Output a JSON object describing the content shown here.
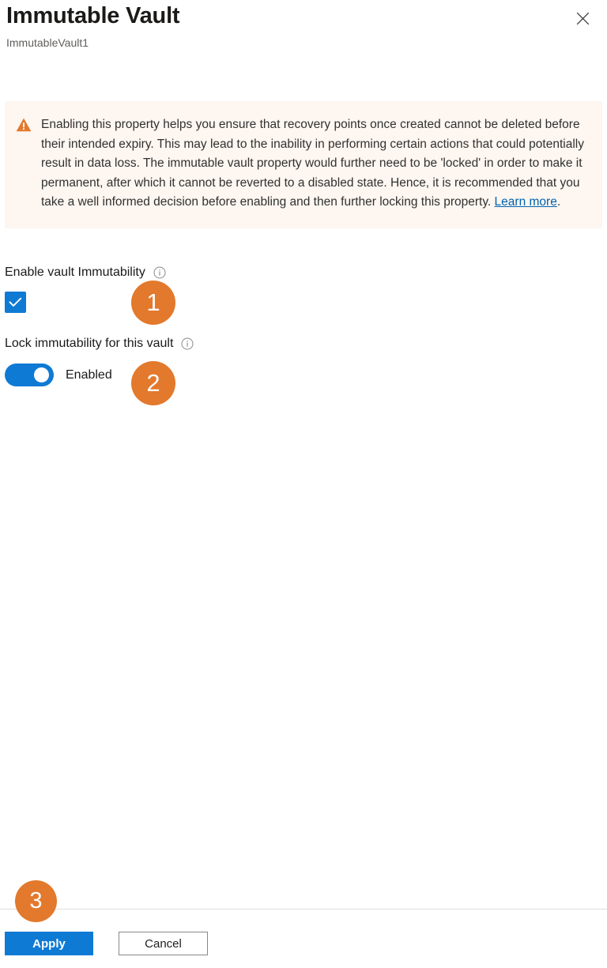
{
  "header": {
    "title": "Immutable Vault",
    "subtitle": "ImmutableVault1",
    "close_icon": "close-icon"
  },
  "warning": {
    "icon": "warning-triangle-icon",
    "text": "Enabling this property helps you ensure that recovery points once created cannot be deleted before their intended expiry. This may lead to the inability in performing certain actions that could potentially result in data loss. The immutable vault property would further need to be 'locked' in order to make it permanent, after which it cannot be reverted to a disabled state. Hence, it is recommended that you take a well informed decision before enabling and then further locking this property. ",
    "link_label": "Learn more",
    "text_after_link": ".",
    "background_color": "#FDF6F1",
    "icon_color": "#E3792C",
    "link_color": "#0063B1"
  },
  "fields": {
    "enable_immutability": {
      "label": "Enable vault Immutability",
      "info_icon": "info-icon",
      "checkbox_checked": true,
      "accent_color": "#0F7AD4"
    },
    "lock_immutability": {
      "label": "Lock immutability for this vault",
      "info_icon": "info-icon",
      "toggle_on": true,
      "toggle_state_label": "Enabled",
      "accent_color": "#0F7AD4"
    }
  },
  "footer": {
    "apply_label": "Apply",
    "cancel_label": "Cancel",
    "apply_color": "#0F7AD4"
  },
  "annotations": {
    "badge_color": "#E3792C",
    "steps": [
      {
        "number": "1"
      },
      {
        "number": "2"
      },
      {
        "number": "3"
      }
    ]
  }
}
